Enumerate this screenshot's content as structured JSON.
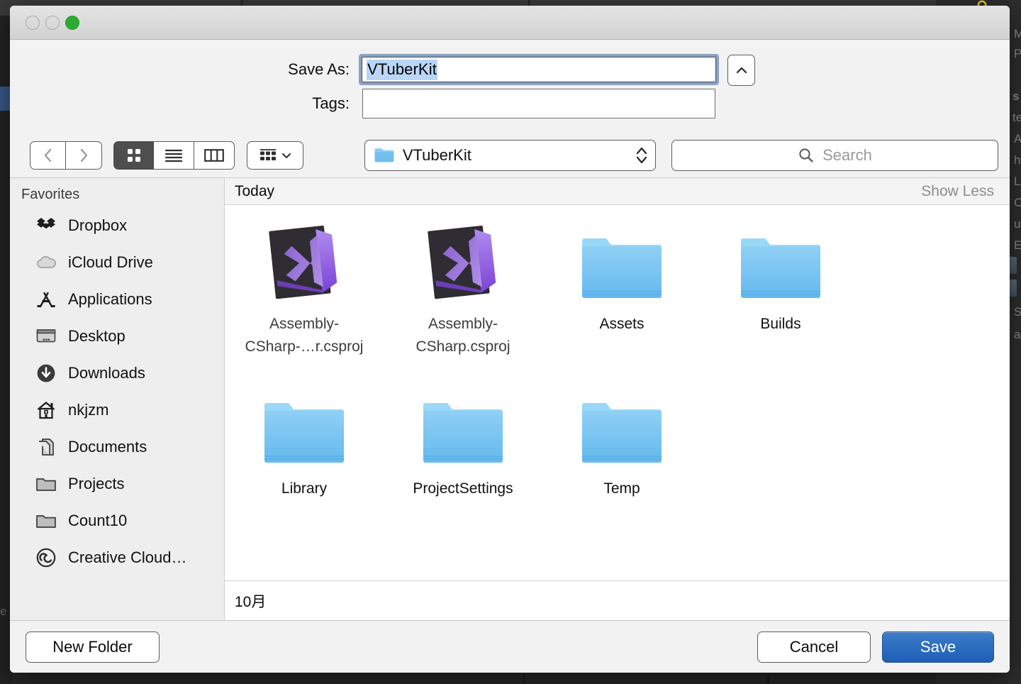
{
  "window": {
    "traffic_lights": [
      {
        "name": "close-button",
        "state": "disabled"
      },
      {
        "name": "minimize-button",
        "state": "disabled"
      },
      {
        "name": "zoom-button",
        "state": "enabled",
        "color": "#2eaa34"
      }
    ]
  },
  "form": {
    "save_as_label": "Save As:",
    "save_as_value": "VTuberKit",
    "tags_label": "Tags:",
    "tags_value": "",
    "expand_icon": "chevron-up-icon"
  },
  "toolbar": {
    "back_icon": "chevron-left-icon",
    "forward_icon": "chevron-right-icon",
    "view_modes": [
      {
        "name": "icon-view",
        "icon": "grid-icon",
        "active": true
      },
      {
        "name": "list-view",
        "icon": "list-icon",
        "active": false
      },
      {
        "name": "column-view",
        "icon": "columns-icon",
        "active": false
      }
    ],
    "action_menu_icon": "action-menu-icon",
    "action_menu_chevron": "chevron-down-icon",
    "path_folder_icon": "folder-icon",
    "path_label": "VTuberKit",
    "path_stepper_icon": "updown-chevrons-icon",
    "search_icon": "search-icon",
    "search_placeholder": "Search",
    "search_value": ""
  },
  "sidebar": {
    "header": "Favorites",
    "items": [
      {
        "label": "Dropbox",
        "icon": "dropbox-icon"
      },
      {
        "label": "iCloud Drive",
        "icon": "cloud-icon"
      },
      {
        "label": "Applications",
        "icon": "applications-icon"
      },
      {
        "label": "Desktop",
        "icon": "desktop-icon"
      },
      {
        "label": "Downloads",
        "icon": "download-circle-icon"
      },
      {
        "label": "nkjzm",
        "icon": "home-icon"
      },
      {
        "label": "Documents",
        "icon": "documents-icon"
      },
      {
        "label": "Projects",
        "icon": "folder-gray-icon"
      },
      {
        "label": "Count10",
        "icon": "folder-gray-icon"
      },
      {
        "label": "Creative Cloud…",
        "icon": "creative-cloud-icon"
      }
    ]
  },
  "content": {
    "group_header_title": "Today",
    "group_header_action": "Show Less",
    "items": [
      {
        "name": "Assembly-\nCSharp-…r.csproj",
        "kind": "visual-studio-project",
        "icon": "visual-studio-icon"
      },
      {
        "name": "Assembly-\nCSharp.csproj",
        "kind": "visual-studio-project",
        "icon": "visual-studio-icon"
      },
      {
        "name": "Assets",
        "kind": "folder",
        "icon": "folder-blue-icon"
      },
      {
        "name": "Builds",
        "kind": "folder",
        "icon": "folder-blue-icon"
      },
      {
        "name": "Library",
        "kind": "folder",
        "icon": "folder-blue-icon"
      },
      {
        "name": "ProjectSettings",
        "kind": "folder",
        "icon": "folder-blue-icon"
      },
      {
        "name": "Temp",
        "kind": "folder",
        "icon": "folder-blue-icon"
      }
    ],
    "group_footer_title": "10月"
  },
  "buttons": {
    "new_folder": "New Folder",
    "cancel": "Cancel",
    "save": "Save"
  },
  "colors": {
    "accent_blue": "#1d5fb6",
    "selection_blue": "#b9d6f7",
    "focus_ring": "#8ba2c2",
    "folder_blue": "#6cbcf0",
    "vs_purple": "#9b6ede"
  }
}
